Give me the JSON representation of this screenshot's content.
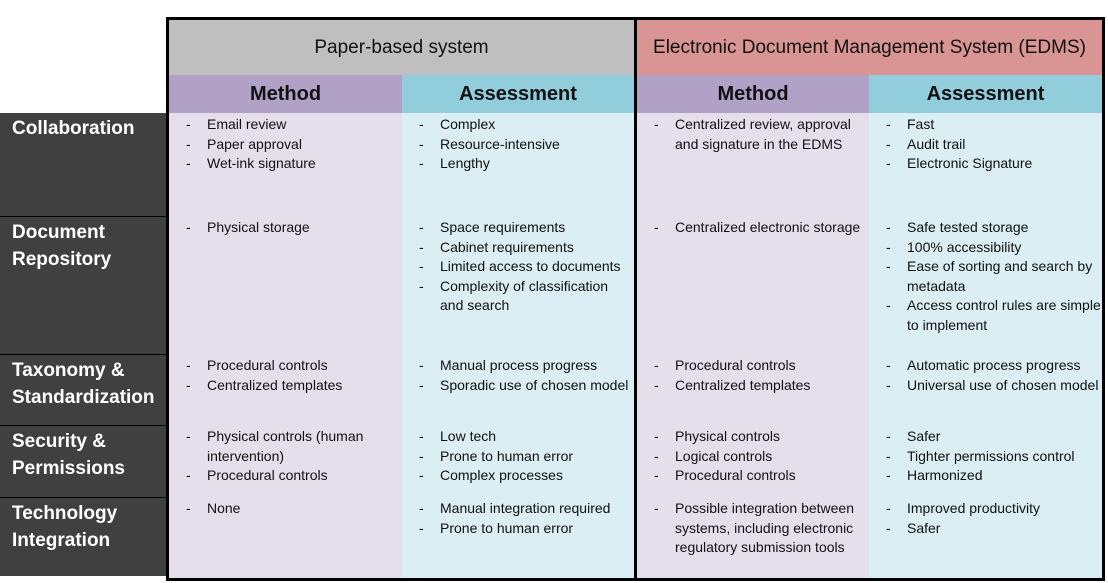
{
  "systems": {
    "paper": {
      "title": "Paper-based system"
    },
    "edms": {
      "title": "Electronic Document Management System (EDMS)"
    }
  },
  "column_headers": {
    "method": "Method",
    "assessment": "Assessment"
  },
  "colors": {
    "paper_header": "#bfbfbf",
    "edms_header": "#d99594",
    "method_header": "#b2a1c7",
    "assessment_header": "#92cddc",
    "method_cell": "#e5dfec",
    "assessment_cell": "#daeef3",
    "row_label_bg": "#404040"
  },
  "bullet": "-",
  "rows": [
    {
      "label_lines": [
        "Collaboration"
      ],
      "paper_method": [
        "Email review",
        "Paper approval",
        "Wet-ink signature"
      ],
      "paper_assessment": [
        "Complex",
        "Resource-intensive",
        "Lengthy"
      ],
      "edms_method": [
        "Centralized review, approval and signature in the EDMS"
      ],
      "edms_assessment": [
        "Fast",
        "Audit trail",
        "Electronic Signature"
      ]
    },
    {
      "label_lines": [
        "Document",
        "Repository"
      ],
      "paper_method": [
        "Physical storage"
      ],
      "paper_assessment": [
        "Space requirements",
        "Cabinet requirements",
        "Limited access to documents",
        "Complexity of classification and search"
      ],
      "edms_method": [
        "Centralized electronic storage"
      ],
      "edms_assessment": [
        "Safe tested storage",
        "100% accessibility",
        "Ease of sorting and search by metadata",
        "Access control rules are simple to implement"
      ]
    },
    {
      "label_lines": [
        "Taxonomy &",
        "Standardization"
      ],
      "paper_method": [
        "Procedural controls",
        "Centralized templates"
      ],
      "paper_assessment": [
        "Manual process progress",
        "Sporadic use of chosen model"
      ],
      "edms_method": [
        "Procedural controls",
        "Centralized templates"
      ],
      "edms_assessment": [
        "Automatic process progress",
        "Universal use of chosen model"
      ]
    },
    {
      "label_lines": [
        "Security &",
        "Permissions"
      ],
      "paper_method": [
        "Physical controls (human intervention)",
        "Procedural controls"
      ],
      "paper_assessment": [
        "Low tech",
        "Prone to human error",
        "Complex processes"
      ],
      "edms_method": [
        "Physical controls",
        "Logical controls",
        "Procedural controls"
      ],
      "edms_assessment": [
        "Safer",
        "Tighter permissions control",
        "Harmonized"
      ]
    },
    {
      "label_lines": [
        "Technology",
        "Integration"
      ],
      "paper_method": [
        "None"
      ],
      "paper_assessment": [
        "Manual integration required",
        "Prone to human error"
      ],
      "edms_method": [
        "Possible integration between systems, including electronic regulatory submission tools"
      ],
      "edms_assessment": [
        "Improved productivity",
        "Safer"
      ]
    }
  ]
}
